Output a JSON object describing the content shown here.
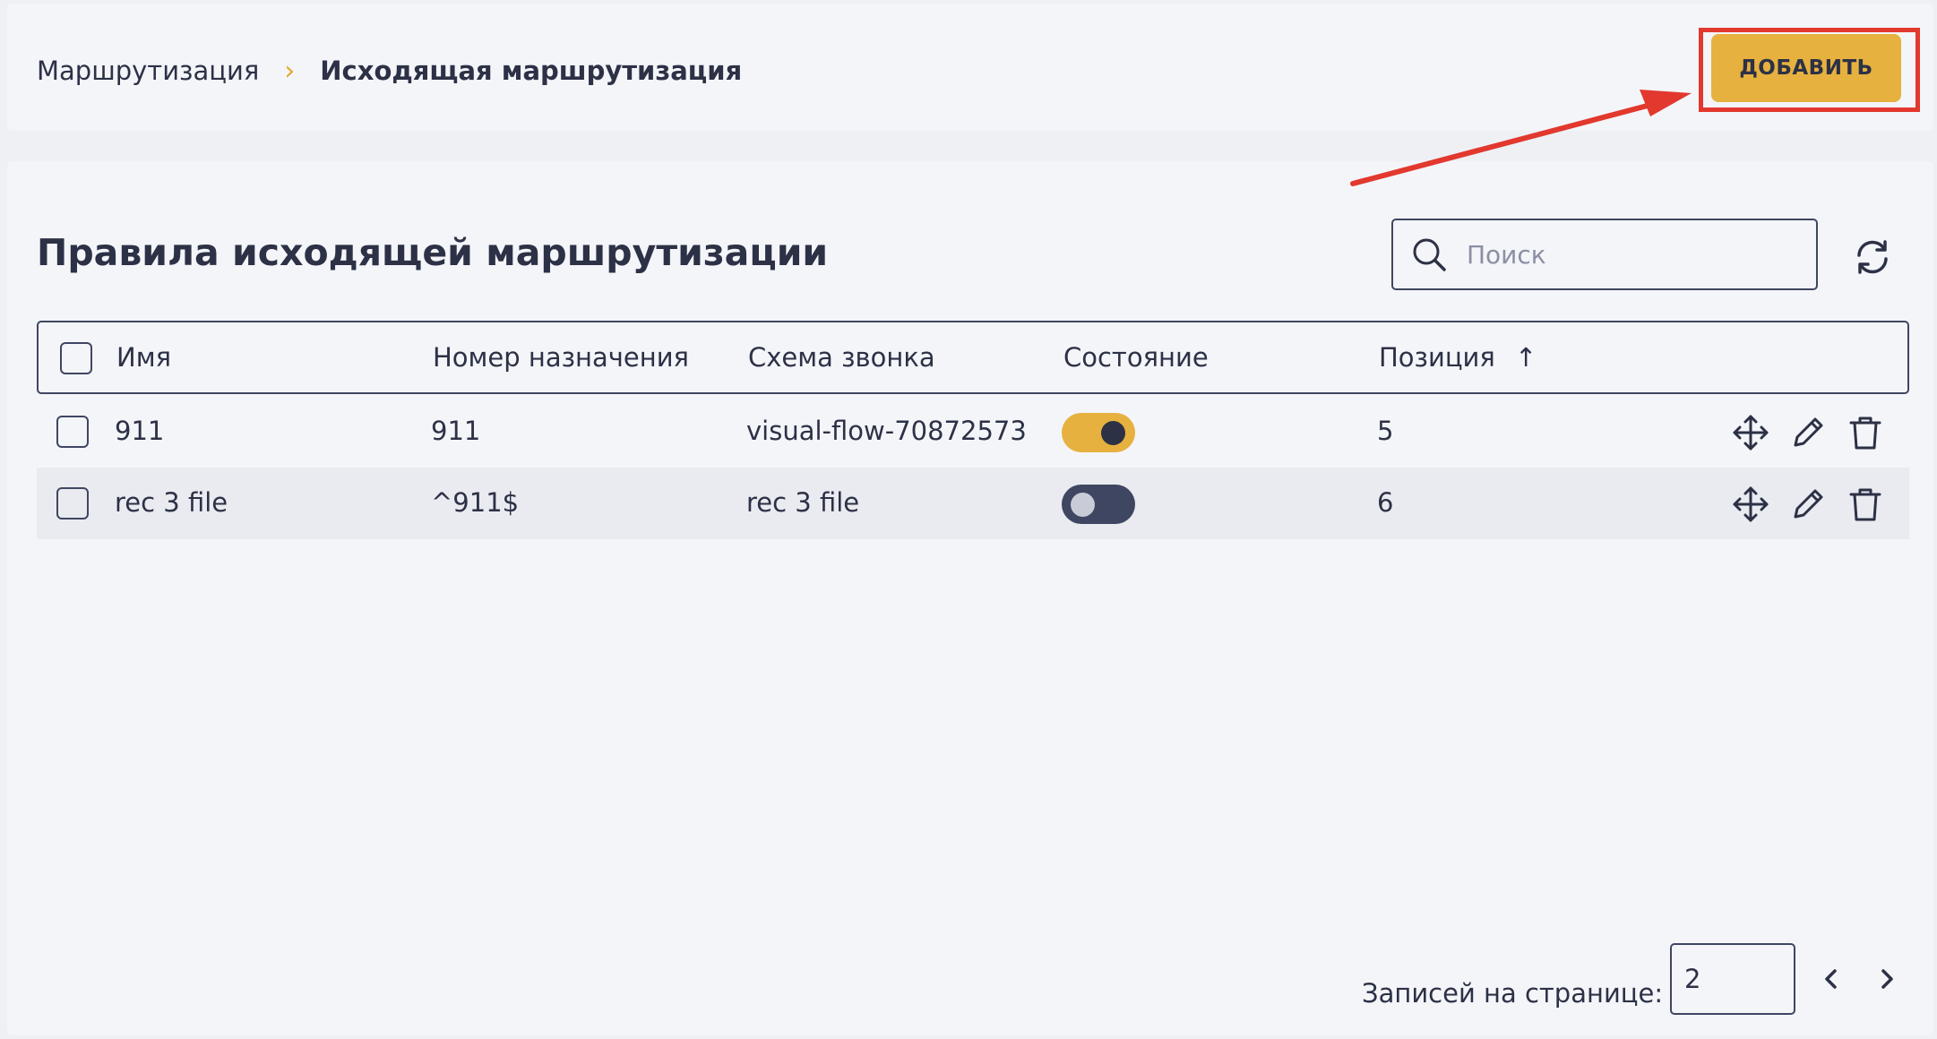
{
  "breadcrumb": {
    "parent": "Маршрутизация",
    "separator": "›",
    "current": "Исходящая маршрутизация"
  },
  "toolbar": {
    "add_label": "ДОБАВИТЬ"
  },
  "main": {
    "title": "Правила исходящей маршрутизации",
    "search": {
      "placeholder": "Поиск",
      "value": ""
    }
  },
  "table": {
    "columns": [
      {
        "label": "Имя"
      },
      {
        "label": "Номер назначения"
      },
      {
        "label": "Схема звонка"
      },
      {
        "label": "Состояние"
      },
      {
        "label": "Позиция",
        "sort": "↑"
      }
    ],
    "rows": [
      {
        "name": "911",
        "destination": "911",
        "scheme": "visual-flow-70872573",
        "state": "on",
        "position": "5"
      },
      {
        "name": "rec 3 file",
        "destination": "^911$",
        "scheme": "rec 3 file",
        "state": "off",
        "position": "6"
      }
    ]
  },
  "pager": {
    "label": "Записей на странице:",
    "per_page": "2"
  },
  "colors": {
    "accent": "#e6b13e",
    "dark": "#3f4662",
    "annotation": "#e2382e"
  },
  "icons": [
    "search-icon",
    "refresh-icon",
    "move-icon",
    "edit-icon",
    "trash-icon",
    "chevron-left-icon",
    "chevron-right-icon",
    "sort-asc-icon"
  ]
}
